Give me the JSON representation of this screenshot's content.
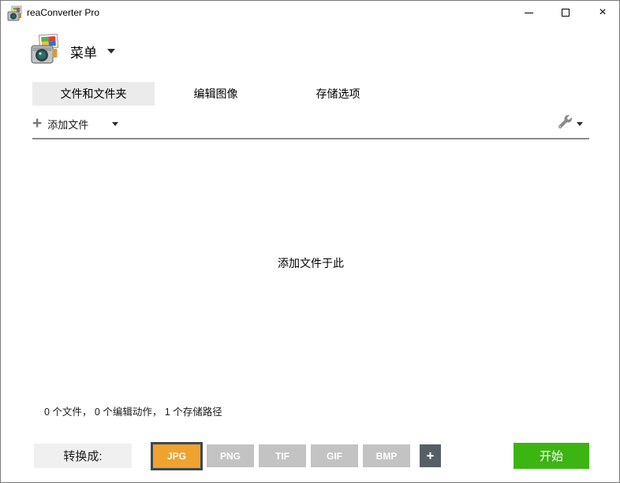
{
  "window": {
    "title": "reaConverter Pro"
  },
  "titlebar": {
    "close_glyph": "×"
  },
  "menu": {
    "label": "菜单"
  },
  "tabs": [
    {
      "label": "文件和文件夹",
      "active": true
    },
    {
      "label": "编辑图像",
      "active": false
    },
    {
      "label": "存储选项",
      "active": false
    }
  ],
  "toolbar": {
    "add_files_label": "添加文件",
    "plus_glyph": "+"
  },
  "dropzone": {
    "hint": "添加文件于此"
  },
  "status": {
    "text": "0 个文件， 0 个编辑动作， 1 个存储路径"
  },
  "bottom": {
    "convert_label": "转换成:",
    "formats": [
      {
        "label": "JPG",
        "active": true
      },
      {
        "label": "PNG",
        "active": false
      },
      {
        "label": "TIF",
        "active": false
      },
      {
        "label": "GIF",
        "active": false
      },
      {
        "label": "BMP",
        "active": false
      }
    ],
    "add_format_glyph": "+",
    "start_label": "开始"
  },
  "colors": {
    "accent_orange": "#f0a22e",
    "accent_orange_border": "#3c4a54",
    "accent_green": "#3cb412",
    "button_gray": "#c3c3c3",
    "dark_button": "#575f66",
    "active_tab_bg": "#ebebeb",
    "convert_box_bg": "#f0f0f0",
    "separator": "#8c8c8c",
    "window_border": "#7a7a7a"
  }
}
